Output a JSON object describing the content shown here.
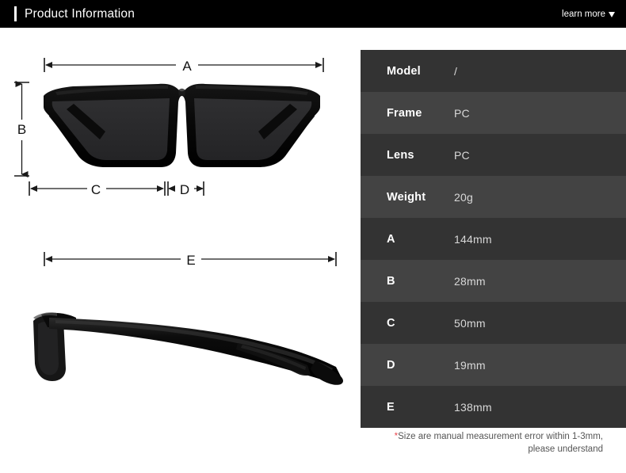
{
  "header": {
    "title": "Product Information",
    "learn_more_label": "learn more",
    "caret_icon": "chevron-down-icon",
    "background_color": "#000000",
    "accent_color": "#ffffff"
  },
  "diagram": {
    "front_view_alt": "sunglasses-front-view",
    "side_view_alt": "sunglasses-side-view",
    "dimension_labels": {
      "a": "A",
      "b": "B",
      "c": "C",
      "d": "D",
      "e": "E"
    }
  },
  "spec_table": {
    "row_color_odd": "#333333",
    "row_color_even": "#434343",
    "rows": [
      {
        "label": "Model",
        "value": "/"
      },
      {
        "label": "Frame",
        "value": "PC"
      },
      {
        "label": "Lens",
        "value": "PC"
      },
      {
        "label": "Weight",
        "value": "20g"
      },
      {
        "label": "A",
        "value": "144mm"
      },
      {
        "label": "B",
        "value": "28mm"
      },
      {
        "label": "C",
        "value": "50mm"
      },
      {
        "label": "D",
        "value": "19mm"
      },
      {
        "label": "E",
        "value": "138mm"
      }
    ]
  },
  "footnote": {
    "star": "*",
    "line1": "Size are manual measurement error within 1-3mm,",
    "line2": "please understand",
    "star_color": "#e8484f"
  }
}
